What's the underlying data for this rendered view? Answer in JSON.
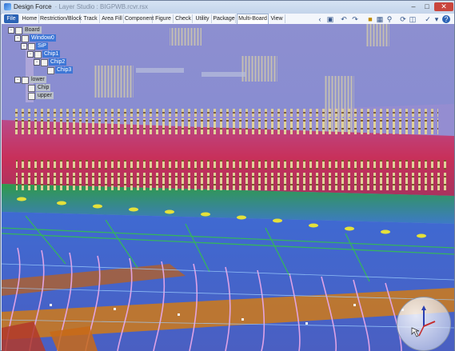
{
  "window": {
    "title": "Design Force",
    "subtitle": "· Layer Studio : BIGPWB.rcvr.rsx"
  },
  "menu": {
    "tabs": [
      {
        "label": "File"
      },
      {
        "label": "Home"
      },
      {
        "label": "Restriction/Block"
      },
      {
        "label": "Track"
      },
      {
        "label": "Area Fill"
      },
      {
        "label": "Component"
      },
      {
        "label": "Figure"
      },
      {
        "label": "Check"
      },
      {
        "label": "Utility"
      },
      {
        "label": "Package"
      },
      {
        "label": "Multi-Board"
      },
      {
        "label": "View"
      }
    ],
    "active_tab": "Multi-Board"
  },
  "tree": {
    "nodes": [
      {
        "label": "Board",
        "expander": "−",
        "selected": false
      },
      {
        "label": "Window0",
        "expander": "−",
        "selected": true
      },
      {
        "label": "SiP",
        "expander": "−",
        "selected": true
      },
      {
        "label": "Chip1",
        "expander": "−",
        "selected": true
      },
      {
        "label": "Chip2",
        "expander": "−",
        "selected": true
      },
      {
        "label": "Chip3",
        "expander": "",
        "selected": true
      },
      {
        "label": "lower",
        "expander": "−",
        "selected": false
      },
      {
        "label": "Chip",
        "expander": "",
        "selected": false
      },
      {
        "label": "upper",
        "expander": "",
        "selected": false
      }
    ]
  },
  "colors": {
    "board_red": "#c8305a",
    "board_blue": "#3f5fd0",
    "pin_gold": "#d6c47a",
    "trace_pink": "#e6a6e8",
    "trace_green": "#33c24a",
    "trace_orange": "#d07a18",
    "sky": "#8d8fd0",
    "accent": "#2b63b5"
  },
  "icons": {
    "save": "save-icon",
    "undo": "undo-icon",
    "redo": "redo-icon",
    "view3d": "3d-view-icon",
    "help": "help-icon"
  }
}
